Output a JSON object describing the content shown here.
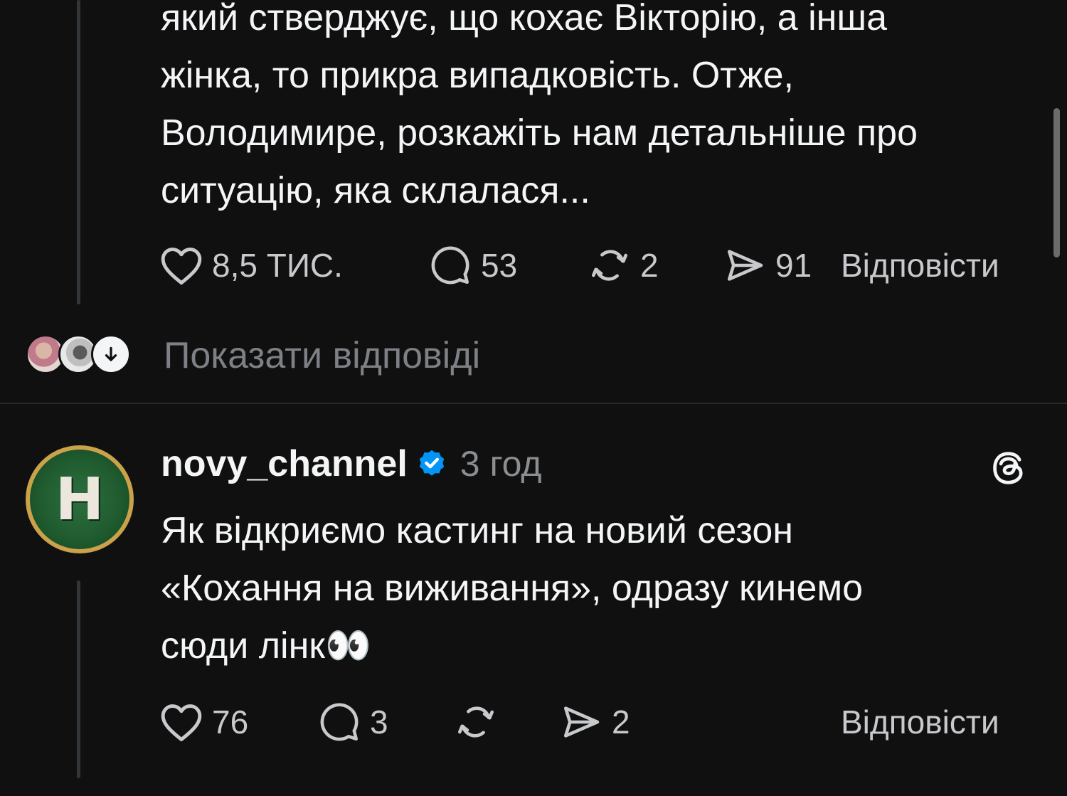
{
  "post1": {
    "text_lines": [
      "який стверджує, що кохає Вікторію, а інша",
      "жінка, то прикра випадковість. Отже,",
      "Володимире, розкажіть нам детальніше про",
      "ситуацію, яка склалася..."
    ],
    "actions": {
      "likes": "8,5 ТИС.",
      "comments": "53",
      "reposts": "2",
      "shares": "91",
      "reply_label": "Відповісти"
    },
    "show_replies_label": "Показати відповіді"
  },
  "post2": {
    "avatar_letter": "H",
    "username": "novy_channel",
    "time": "3 год",
    "text_lines": [
      "Як відкриємо кастинг на новий сезон",
      "«Кохання на виживання», одразу кинемо",
      "сюди лінк👀"
    ],
    "actions": {
      "likes": "76",
      "comments": "3",
      "reposts": "",
      "shares": "2",
      "reply_label": "Відповісти"
    }
  },
  "icons": {
    "like": "heart-icon",
    "comment": "speech-bubble-icon",
    "repost": "repost-icon",
    "share": "send-icon",
    "verified": "verified-badge-icon",
    "app": "threads-logo-icon",
    "expand": "arrow-down-icon"
  },
  "colors": {
    "background": "#101010",
    "text": "#f3f5f7",
    "muted": "#8a8d91",
    "verified": "#0095f6",
    "avatar_green": "#1f5a2e",
    "avatar_ring": "#c9a24a"
  }
}
